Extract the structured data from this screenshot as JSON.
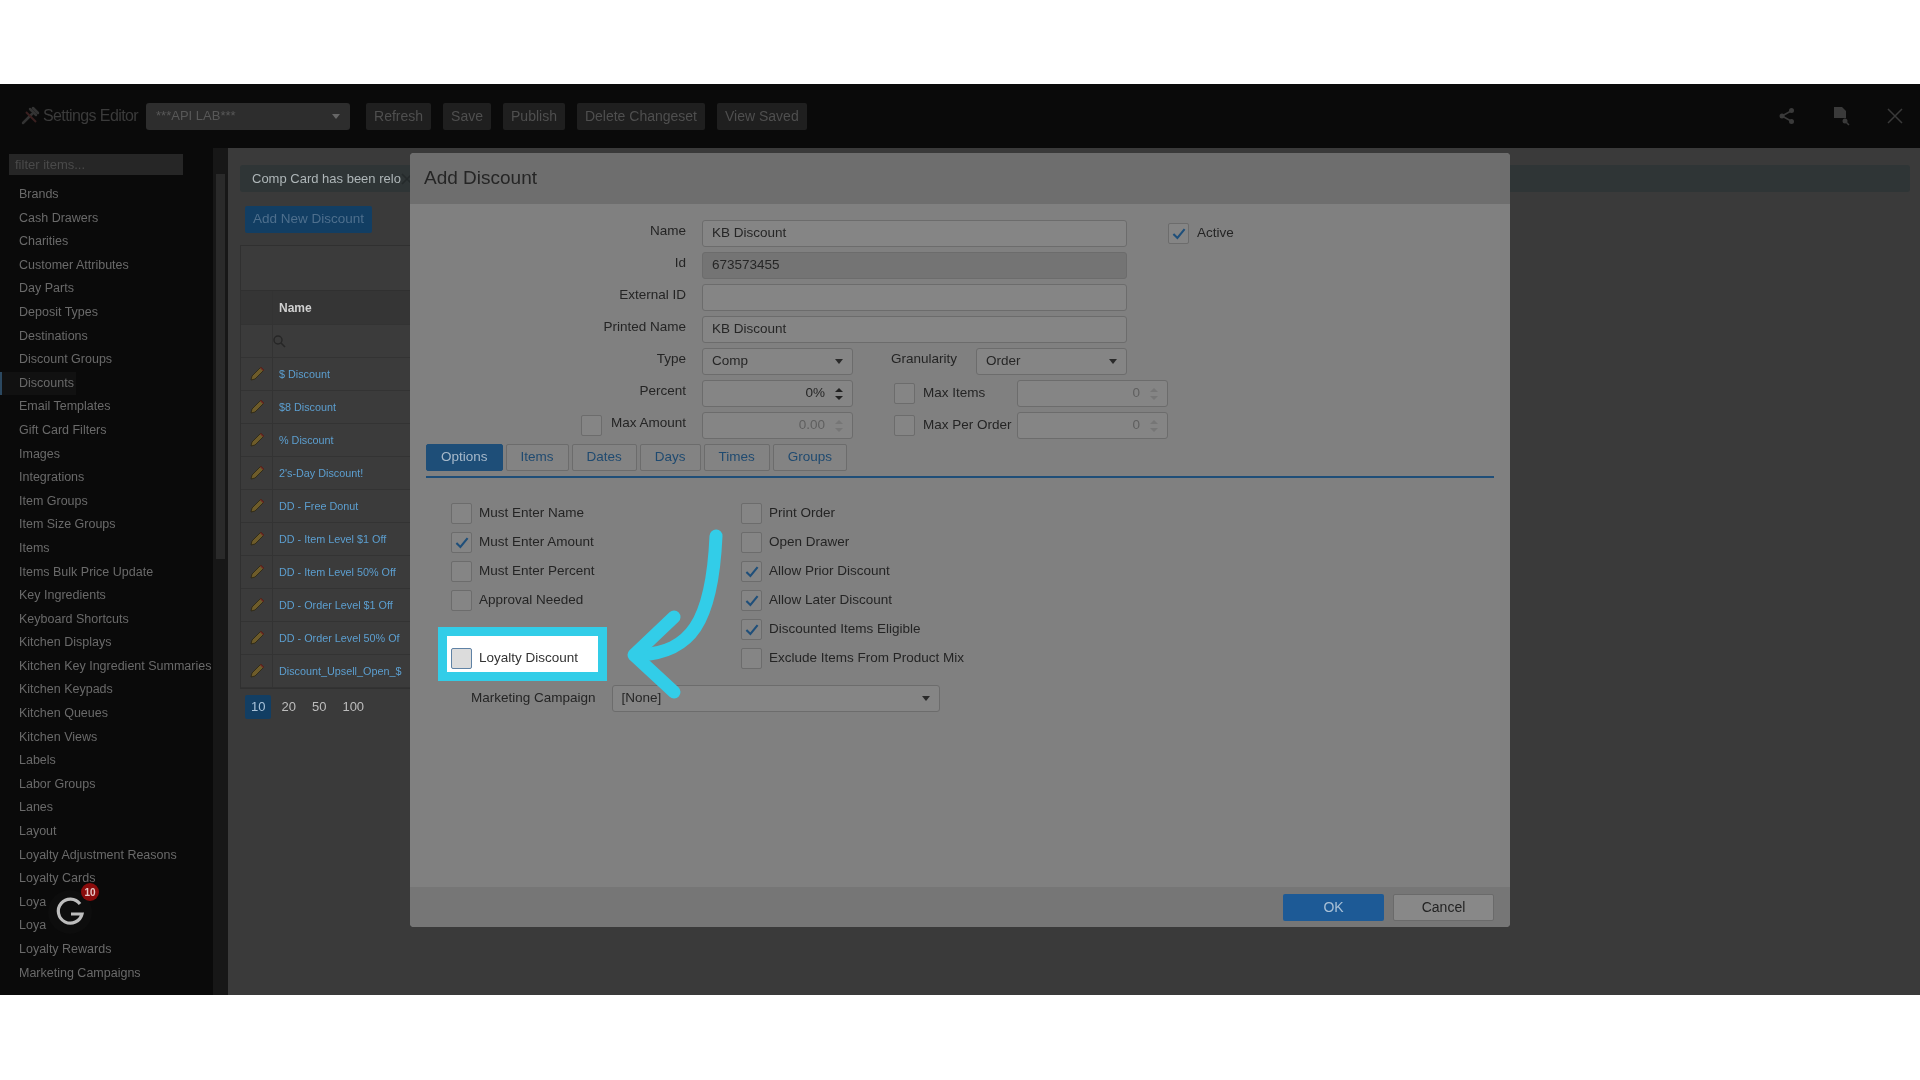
{
  "topbar": {
    "app_title": "Settings Editor",
    "location_select": "***API LAB***",
    "buttons": [
      "Refresh",
      "Save",
      "Publish",
      "Delete Changeset",
      "View Saved"
    ]
  },
  "sidebar": {
    "filter_placeholder": "filter items...",
    "items": [
      {
        "label": "Brands",
        "selected": false
      },
      {
        "label": "Cash Drawers",
        "selected": false
      },
      {
        "label": "Charities",
        "selected": false
      },
      {
        "label": "Customer Attributes",
        "selected": false
      },
      {
        "label": "Day Parts",
        "selected": false
      },
      {
        "label": "Deposit Types",
        "selected": false
      },
      {
        "label": "Destinations",
        "selected": false
      },
      {
        "label": "Discount Groups",
        "selected": false
      },
      {
        "label": "Discounts",
        "selected": true
      },
      {
        "label": "Email Templates",
        "selected": false
      },
      {
        "label": "Gift Card Filters",
        "selected": false
      },
      {
        "label": "Images",
        "selected": false
      },
      {
        "label": "Integrations",
        "selected": false
      },
      {
        "label": "Item Groups",
        "selected": false
      },
      {
        "label": "Item Size Groups",
        "selected": false
      },
      {
        "label": "Items",
        "selected": false
      },
      {
        "label": "Items Bulk Price Update",
        "selected": false
      },
      {
        "label": "Key Ingredients",
        "selected": false
      },
      {
        "label": "Keyboard Shortcuts",
        "selected": false
      },
      {
        "label": "Kitchen Displays",
        "selected": false
      },
      {
        "label": "Kitchen Key Ingredient Summaries",
        "selected": false
      },
      {
        "label": "Kitchen Keypads",
        "selected": false
      },
      {
        "label": "Kitchen Queues",
        "selected": false
      },
      {
        "label": "Kitchen Views",
        "selected": false
      },
      {
        "label": "Labels",
        "selected": false
      },
      {
        "label": "Labor Groups",
        "selected": false
      },
      {
        "label": "Lanes",
        "selected": false
      },
      {
        "label": "Layout",
        "selected": false
      },
      {
        "label": "Loyalty Adjustment Reasons",
        "selected": false
      },
      {
        "label": "Loyalty Cards",
        "selected": false
      },
      {
        "label": "Loya",
        "selected": false
      },
      {
        "label": "Loya",
        "selected": false
      },
      {
        "label": "Loyalty Rewards",
        "selected": false
      },
      {
        "label": "Marketing Campaigns",
        "selected": false
      }
    ]
  },
  "launcher": {
    "badge": "10"
  },
  "main": {
    "alert": "Comp Card has been relo",
    "add_button": "Add New Discount",
    "table": {
      "columns": [
        "Name"
      ],
      "rows": [
        "$ Discount",
        "$8 Discount",
        "% Discount",
        "2's-Day Discount!",
        "DD - Free Donut",
        "DD - Item Level $1 Off",
        "DD - Item Level 50% Off",
        "DD - Order Level $1 Off",
        "DD - Order Level 50% Of",
        "Discount_Upsell_Open_$"
      ]
    },
    "page_sizes": [
      {
        "label": "10",
        "selected": true
      },
      {
        "label": "20",
        "selected": false
      },
      {
        "label": "50",
        "selected": false
      },
      {
        "label": "100",
        "selected": false
      }
    ]
  },
  "dialog": {
    "title": "Add Discount",
    "name": {
      "label": "Name",
      "value": "KB Discount"
    },
    "active": {
      "label": "Active",
      "checked": true
    },
    "id": {
      "label": "Id",
      "value": "673573455",
      "readonly": true
    },
    "external_id": {
      "label": "External ID"
    },
    "printed_name": {
      "label": "Printed Name",
      "value": "KB Discount"
    },
    "type": {
      "label": "Type",
      "value": "Comp"
    },
    "granularity": {
      "label": "Granularity",
      "value": "Order"
    },
    "percent": {
      "label": "Percent",
      "value": "0%",
      "disabled": false
    },
    "max_items": {
      "label": "Max Items",
      "checked": false,
      "value": "0",
      "disabled": true
    },
    "max_amount": {
      "label": "Max Amount",
      "checked": false,
      "value": "0.00",
      "disabled": true
    },
    "max_per_order": {
      "label": "Max Per Order",
      "checked": false,
      "value": "0",
      "disabled": true
    },
    "tabs": [
      {
        "label": "Options",
        "selected": true
      },
      {
        "label": "Items",
        "selected": false
      },
      {
        "label": "Dates",
        "selected": false
      },
      {
        "label": "Days",
        "selected": false
      },
      {
        "label": "Times",
        "selected": false
      },
      {
        "label": "Groups",
        "selected": false
      }
    ],
    "options_left": [
      {
        "label": "Must Enter Name",
        "checked": false,
        "highlighted": false
      },
      {
        "label": "Must Enter Amount",
        "checked": true,
        "highlighted": false
      },
      {
        "label": "Must Enter Percent",
        "checked": false,
        "highlighted": false
      },
      {
        "label": "Approval Needed",
        "checked": false,
        "highlighted": false
      },
      {
        "label": "Loyalty Discount",
        "checked": false,
        "highlighted": true
      }
    ],
    "options_right": [
      {
        "label": "Print Order",
        "checked": false,
        "highlighted": false
      },
      {
        "label": "Open Drawer",
        "checked": false,
        "highlighted": false
      },
      {
        "label": "Allow Prior Discount",
        "checked": true,
        "highlighted": false
      },
      {
        "label": "Allow Later Discount",
        "checked": true,
        "highlighted": false
      },
      {
        "label": "Discounted Items Eligible",
        "checked": true,
        "highlighted": false
      },
      {
        "label": "Exclude Items From Product Mix",
        "checked": false,
        "highlighted": false
      }
    ],
    "marketing_campaign": {
      "label": "Marketing Campaign",
      "value": "[None]"
    },
    "buttons": {
      "ok": "OK",
      "cancel": "Cancel"
    }
  }
}
